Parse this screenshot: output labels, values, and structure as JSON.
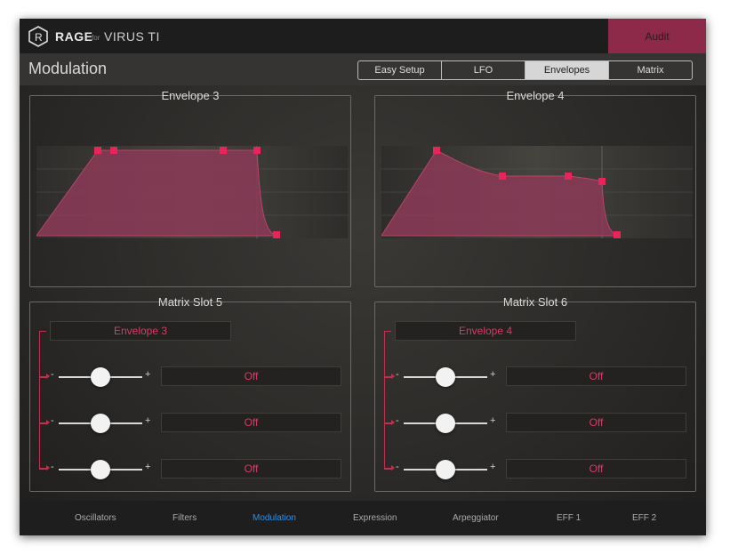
{
  "app": {
    "brand": "RAGE",
    "brand_for": "for",
    "product": "VIRUS TI",
    "audit_label": "Audit"
  },
  "header": {
    "title": "Modulation",
    "tabs": [
      {
        "label": "Easy Setup",
        "active": false
      },
      {
        "label": "LFO",
        "active": false
      },
      {
        "label": "Envelopes",
        "active": true
      },
      {
        "label": "Matrix",
        "active": false
      }
    ]
  },
  "envelopes": [
    {
      "title": "Envelope 3"
    },
    {
      "title": "Envelope 4"
    }
  ],
  "matrix_slots": [
    {
      "title": "Matrix Slot 5",
      "source": "Envelope 3",
      "rows": [
        {
          "minus": "-",
          "plus": "+",
          "amount": 0.5,
          "destination": "Off"
        },
        {
          "minus": "-",
          "plus": "+",
          "amount": 0.5,
          "destination": "Off"
        },
        {
          "minus": "-",
          "plus": "+",
          "amount": 0.5,
          "destination": "Off"
        }
      ]
    },
    {
      "title": "Matrix Slot 6",
      "source": "Envelope 4",
      "rows": [
        {
          "minus": "-",
          "plus": "+",
          "amount": 0.5,
          "destination": "Off"
        },
        {
          "minus": "-",
          "plus": "+",
          "amount": 0.5,
          "destination": "Off"
        },
        {
          "minus": "-",
          "plus": "+",
          "amount": 0.5,
          "destination": "Off"
        }
      ]
    }
  ],
  "bottom_nav": [
    {
      "label": "Oscillators",
      "active": false
    },
    {
      "label": "Filters",
      "active": false
    },
    {
      "label": "Modulation",
      "active": true
    },
    {
      "label": "Expression",
      "active": false
    },
    {
      "label": "Arpeggiator",
      "active": false
    },
    {
      "label": "EFF 1",
      "active": false
    },
    {
      "label": "EFF 2",
      "active": false
    }
  ],
  "colors": {
    "accent": "#d63b67",
    "audit_bg": "#8e2a49",
    "active_nav": "#2f8fe0",
    "envelope_fill": "#8c3a57",
    "envelope_point": "#e8245a"
  }
}
